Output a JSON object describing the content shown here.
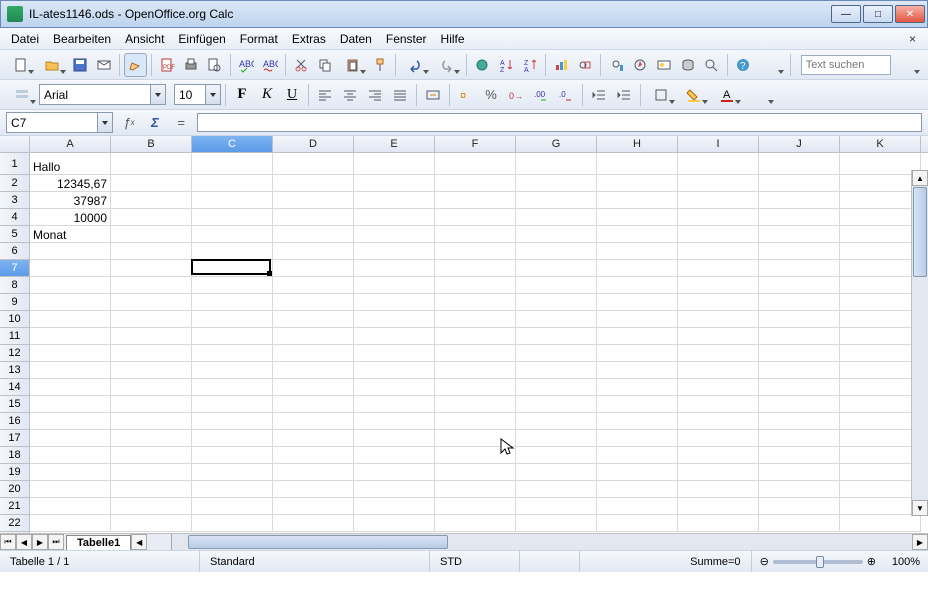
{
  "title": "IL-ates1146.ods - OpenOffice.org Calc",
  "menus": [
    "Datei",
    "Bearbeiten",
    "Ansicht",
    "Einfügen",
    "Format",
    "Extras",
    "Daten",
    "Fenster",
    "Hilfe"
  ],
  "search_placeholder": "Text suchen",
  "font_name": "Arial",
  "font_size": "10",
  "name_box": "C7",
  "columns": [
    "A",
    "B",
    "C",
    "D",
    "E",
    "F",
    "G",
    "H",
    "I",
    "J",
    "K"
  ],
  "selected_col": "C",
  "selected_row": 7,
  "row_count": 22,
  "cells": {
    "A1": {
      "v": "Hallo",
      "align": "l"
    },
    "A2": {
      "v": "12345,67",
      "align": "r"
    },
    "A3": {
      "v": "37987",
      "align": "r"
    },
    "A4": {
      "v": "10000",
      "align": "r"
    },
    "A5": {
      "v": "Monat",
      "align": "l"
    }
  },
  "sheet_tab": "Tabelle1",
  "status": {
    "sheet": "Tabelle 1 / 1",
    "style": "Standard",
    "mode": "STD",
    "sum": "Summe=0",
    "zoom": "100%"
  }
}
